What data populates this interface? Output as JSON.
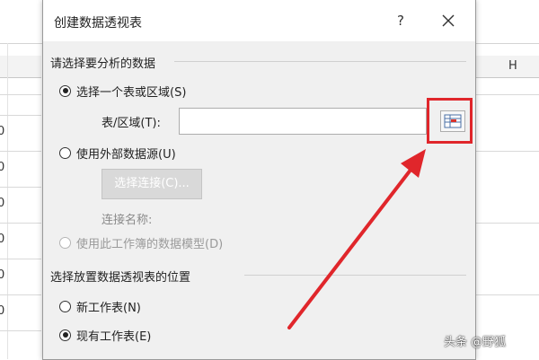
{
  "spreadsheet": {
    "column_header_right": "H",
    "row_values": [
      "0",
      "0",
      "0",
      "0",
      "0",
      "0"
    ]
  },
  "dialog": {
    "title": "创建数据透视表",
    "help_glyph": "?",
    "section_data": "请选择要分析的数据",
    "option_table_range": "选择一个表或区域(S)",
    "table_range_label": "表/区域(T):",
    "table_range_value": "",
    "option_external": "使用外部数据源(U)",
    "choose_connection_button": "选择连接(C)...",
    "connection_name_label": "连接名称:",
    "option_data_model": "使用此工作簿的数据模型(D)",
    "section_location": "选择放置数据透视表的位置",
    "option_new_sheet": "新工作表(N)",
    "option_existing_sheet": "现有工作表(E)",
    "selected_data_option": "option_table_range",
    "selected_location_option": "option_existing_sheet"
  },
  "annotation": {
    "highlight_color": "#e0262b",
    "arrow_color": "#e0262b"
  },
  "watermark": "头条 @野狐",
  "icons": {
    "close": "close-icon",
    "range_picker": "range-picker-icon"
  }
}
